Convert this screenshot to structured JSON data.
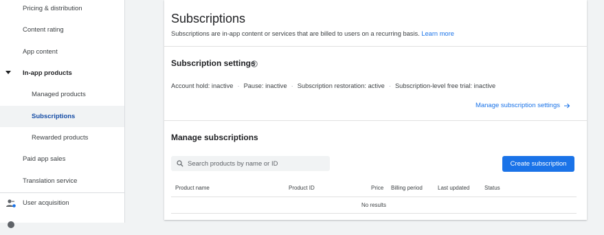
{
  "sidebar": {
    "items": [
      {
        "label": "Pricing & distribution"
      },
      {
        "label": "Content rating"
      },
      {
        "label": "App content"
      },
      {
        "label": "In-app products"
      },
      {
        "label": "Managed products"
      },
      {
        "label": "Subscriptions"
      },
      {
        "label": "Rewarded products"
      },
      {
        "label": "Paid app sales"
      },
      {
        "label": "Translation service"
      },
      {
        "label": "User acquisition",
        "icon": "user-acquisition-icon"
      }
    ],
    "active_item": "Subscriptions",
    "expanded_item": "In-app products"
  },
  "header": {
    "title": "Subscriptions",
    "description": "Subscriptions are in-app content or services that are billed to users on a recurring basis.",
    "learn_more": "Learn more"
  },
  "settings": {
    "title": "Subscription settings",
    "help_icon": "help-icon",
    "statuses": [
      "Account hold: inactive",
      "Pause: inactive",
      "Subscription restoration: active",
      "Subscription-level free trial: inactive"
    ],
    "separator": "·",
    "manage_link": "Manage subscription settings",
    "manage_link_icon": "arrow-right-icon"
  },
  "manage": {
    "title": "Manage subscriptions",
    "search_placeholder": "Search products by name or ID",
    "create_button": "Create subscription",
    "columns": [
      "Product name",
      "Product ID",
      "Price",
      "Billing period",
      "Last updated",
      "Status"
    ],
    "empty_message": "No results"
  },
  "colors": {
    "accent": "#1a73e8",
    "active_nav_text": "#174ea6",
    "background": "#f1f3f4"
  }
}
